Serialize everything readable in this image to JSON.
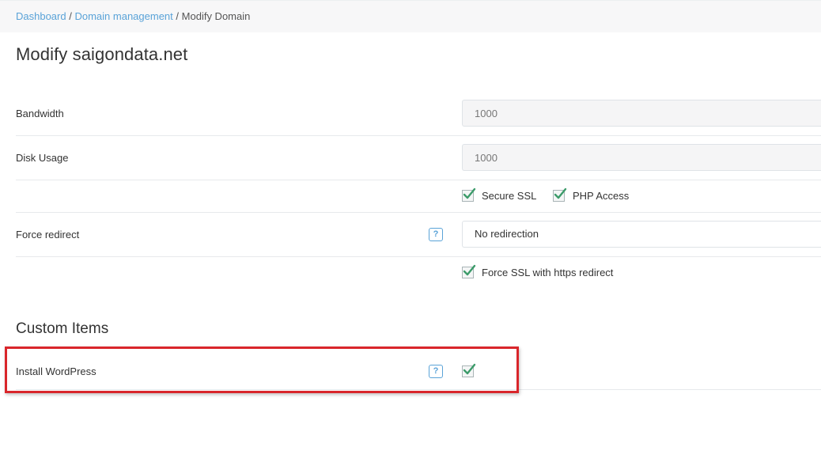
{
  "breadcrumb": {
    "items": [
      "Dashboard",
      "Domain management"
    ],
    "separator": "/",
    "current": "Modify Domain"
  },
  "page": {
    "title": "Modify saigondata.net"
  },
  "form": {
    "bandwidth": {
      "label": "Bandwidth",
      "value": "1000"
    },
    "disk_usage": {
      "label": "Disk Usage",
      "value": "1000"
    },
    "secure_ssl": {
      "label": "Secure SSL",
      "checked": true
    },
    "php_access": {
      "label": "PHP Access",
      "checked": true
    },
    "force_redirect": {
      "label": "Force redirect",
      "help": "?",
      "selected": "No redirection"
    },
    "force_ssl": {
      "label": "Force SSL with https redirect",
      "checked": true
    }
  },
  "custom_items": {
    "title": "Custom Items",
    "install_wordpress": {
      "label": "Install WordPress",
      "help": "?",
      "checked": true
    }
  },
  "colors": {
    "link": "#5aa3d8",
    "check": "#3c9b6a",
    "highlight": "#d9262b"
  },
  "icons": {
    "help": "question-mark-icon",
    "check": "checkmark-icon"
  }
}
